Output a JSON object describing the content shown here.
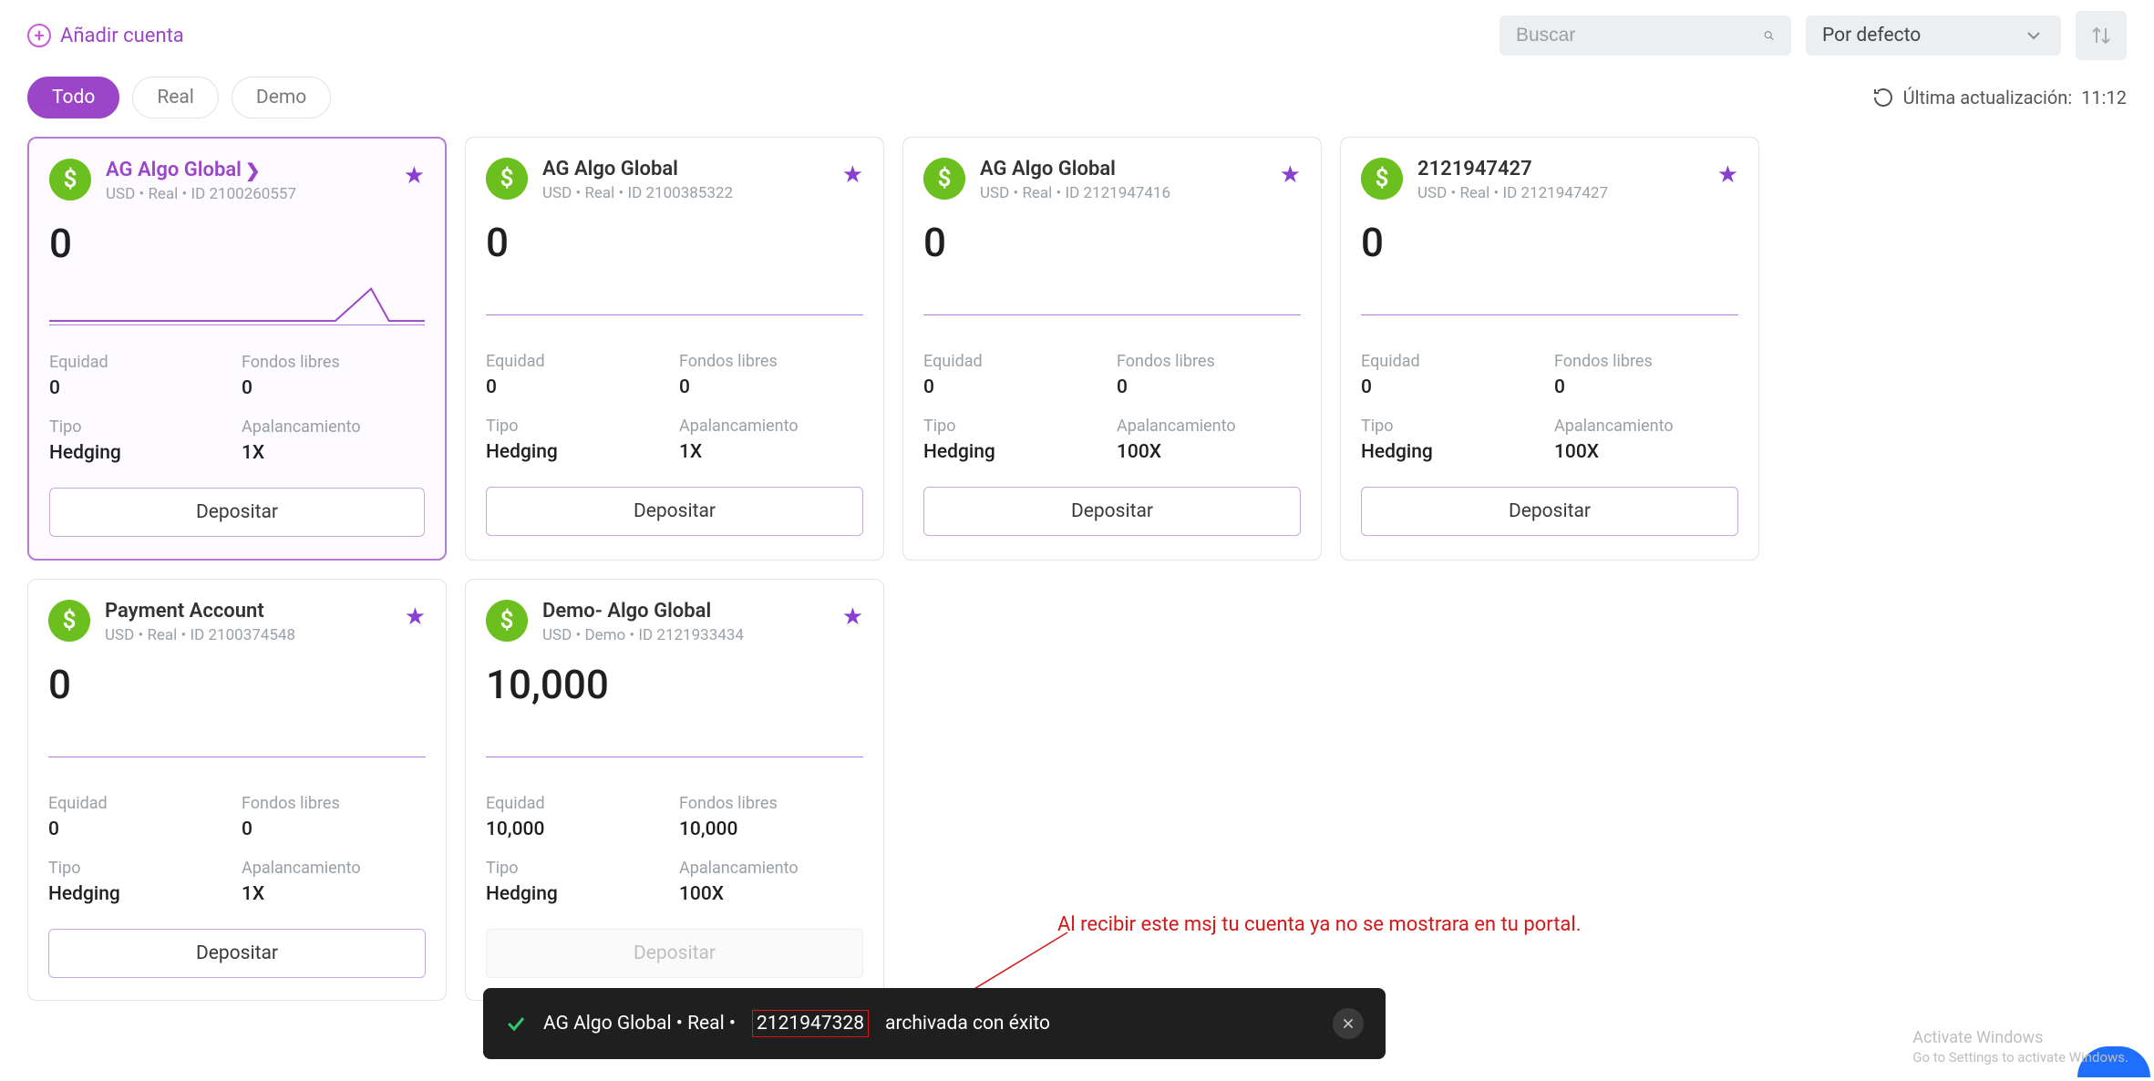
{
  "header": {
    "add_account": "Añadir cuenta",
    "search_placeholder": "Buscar",
    "sort_label": "Por defecto"
  },
  "filters": {
    "all": "Todo",
    "real": "Real",
    "demo": "Demo",
    "last_update_label": "Última actualización:",
    "last_update_time": "11:12"
  },
  "stat_labels": {
    "equity": "Equidad",
    "free_funds": "Fondos libres",
    "type": "Tipo",
    "leverage": "Apalancamiento"
  },
  "deposit_label": "Depositar",
  "accounts": [
    {
      "title": "AG Algo Global",
      "sub": "USD • Real • ID 2100260557",
      "balance": "0",
      "equity": "0",
      "free_funds": "0",
      "type": "Hedging",
      "leverage": "1X",
      "selected": true,
      "spark": "peak",
      "deposit_enabled": true
    },
    {
      "title": "AG Algo Global",
      "sub": "USD • Real • ID 2100385322",
      "balance": "0",
      "equity": "0",
      "free_funds": "0",
      "type": "Hedging",
      "leverage": "1X",
      "selected": false,
      "spark": "flat",
      "deposit_enabled": true
    },
    {
      "title": "AG Algo Global",
      "sub": "USD • Real • ID 2121947416",
      "balance": "0",
      "equity": "0",
      "free_funds": "0",
      "type": "Hedging",
      "leverage": "100X",
      "selected": false,
      "spark": "flat",
      "deposit_enabled": true
    },
    {
      "title": "2121947427",
      "sub": "USD • Real • ID 2121947427",
      "balance": "0",
      "equity": "0",
      "free_funds": "0",
      "type": "Hedging",
      "leverage": "100X",
      "selected": false,
      "spark": "flat",
      "deposit_enabled": true
    },
    {
      "title": "Payment Account",
      "sub": "USD • Real • ID 2100374548",
      "balance": "0",
      "equity": "0",
      "free_funds": "0",
      "type": "Hedging",
      "leverage": "1X",
      "selected": false,
      "spark": "flat",
      "deposit_enabled": true
    },
    {
      "title": "Demo- Algo Global",
      "sub": "USD • Demo • ID 2121933434",
      "balance": "10,000",
      "equity": "10,000",
      "free_funds": "10,000",
      "type": "Hedging",
      "leverage": "100X",
      "selected": false,
      "spark": "flat",
      "deposit_enabled": false
    }
  ],
  "toast": {
    "text_a": "AG Algo Global • Real •",
    "text_highlight": "2121947328",
    "text_b": "archivada con éxito"
  },
  "annotation": {
    "text": "Al recibir este msj tu cuenta ya no se mostrara en tu portal."
  },
  "watermark": {
    "l1": "Activate Windows",
    "l2": "Go to Settings to activate Windows."
  }
}
